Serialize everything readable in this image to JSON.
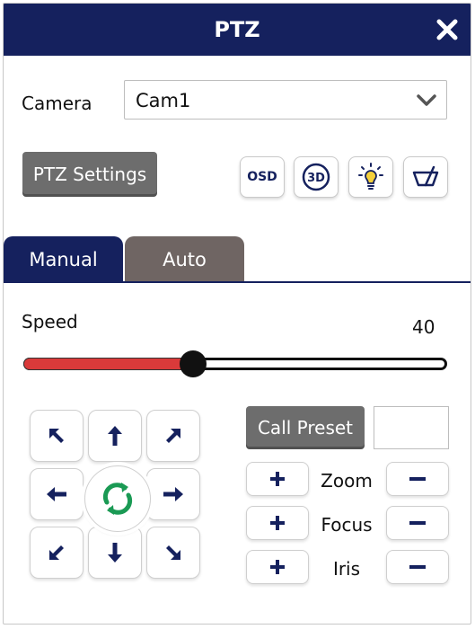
{
  "window": {
    "title": "PTZ"
  },
  "camera": {
    "label": "Camera",
    "selected": "Cam1"
  },
  "buttons": {
    "ptz_settings": "PTZ Settings",
    "osd": "OSD",
    "three_d": "3D",
    "call_preset": "Call Preset"
  },
  "tabs": [
    {
      "label": "Manual",
      "active": true
    },
    {
      "label": "Auto",
      "active": false
    }
  ],
  "speed": {
    "label": "Speed",
    "value": "40",
    "fraction": 0.4
  },
  "preset": {
    "value": ""
  },
  "lens": [
    {
      "label": "Zoom"
    },
    {
      "label": "Focus"
    },
    {
      "label": "Iris"
    }
  ],
  "icons": {
    "close": "close-icon",
    "chevron": "chevron-down-icon",
    "light": "light-bulb-icon",
    "wiper": "wiper-icon",
    "refresh": "refresh-icon",
    "plus": "plus-icon",
    "minus": "minus-icon"
  },
  "colors": {
    "navy": "#15215e",
    "gray_button": "#6d6d6d",
    "auto_tab": "#6f6563",
    "slider_fill": "#d93a3a",
    "refresh_green": "#1a9a54"
  }
}
